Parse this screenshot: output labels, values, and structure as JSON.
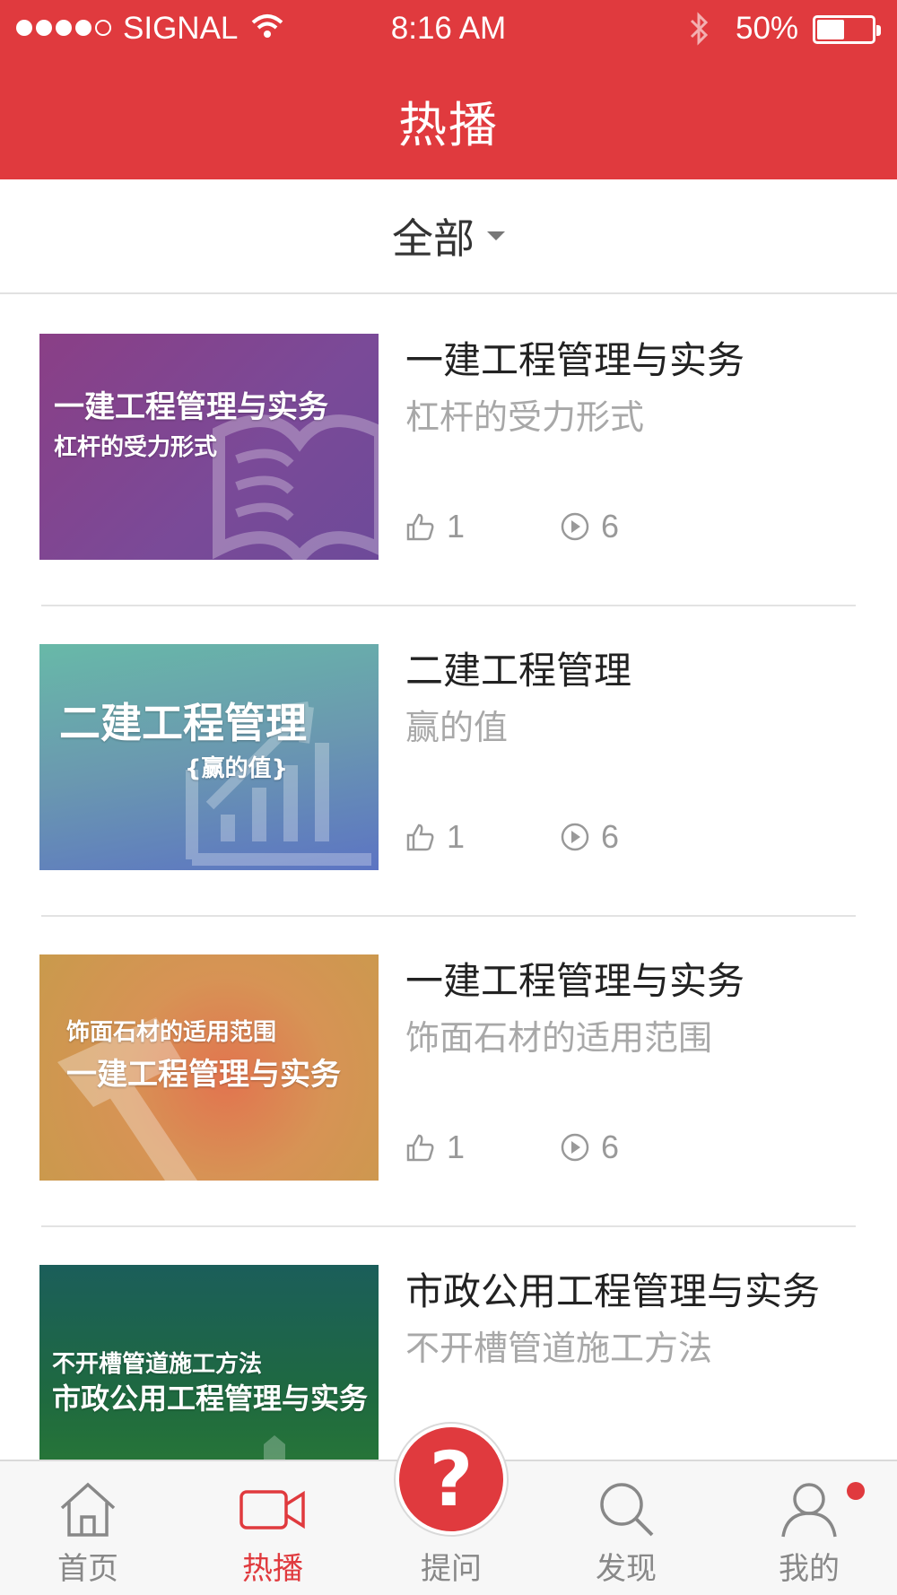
{
  "status_bar": {
    "carrier": "SIGNAL",
    "time": "8:16 AM",
    "battery": "50%",
    "battery_level": 0.5
  },
  "header": {
    "title": "热播"
  },
  "filter": {
    "label": "全部"
  },
  "items": [
    {
      "thumb_lines": [
        "一建工程管理与实务",
        "杠杆的受力形式"
      ],
      "title": "一建工程管理与实务",
      "subtitle": "杠杆的受力形式",
      "likes": "1",
      "plays": "6"
    },
    {
      "thumb_lines": [
        "二建工程管理",
        "{赢的值}"
      ],
      "title": "二建工程管理",
      "subtitle": "赢的值",
      "likes": "1",
      "plays": "6"
    },
    {
      "thumb_lines": [
        "饰面石材的适用范围",
        "一建工程管理与实务"
      ],
      "title": "一建工程管理与实务",
      "subtitle": "饰面石材的适用范围",
      "likes": "1",
      "plays": "6"
    },
    {
      "thumb_lines": [
        "不开槽管道施工方法",
        "市政公用工程管理与实务"
      ],
      "title": "市政公用工程管理与实务",
      "subtitle": "不开槽管道施工方法",
      "likes": "",
      "plays": ""
    }
  ],
  "tabs": [
    {
      "label": "首页",
      "icon": "home-icon"
    },
    {
      "label": "热播",
      "icon": "video-camera-icon"
    },
    {
      "label": "提问",
      "icon": "question-mark-icon"
    },
    {
      "label": "发现",
      "icon": "search-icon"
    },
    {
      "label": "我的",
      "icon": "user-icon"
    }
  ],
  "colors": {
    "brand": "#e03a3e",
    "muted": "#a8a8a8"
  }
}
